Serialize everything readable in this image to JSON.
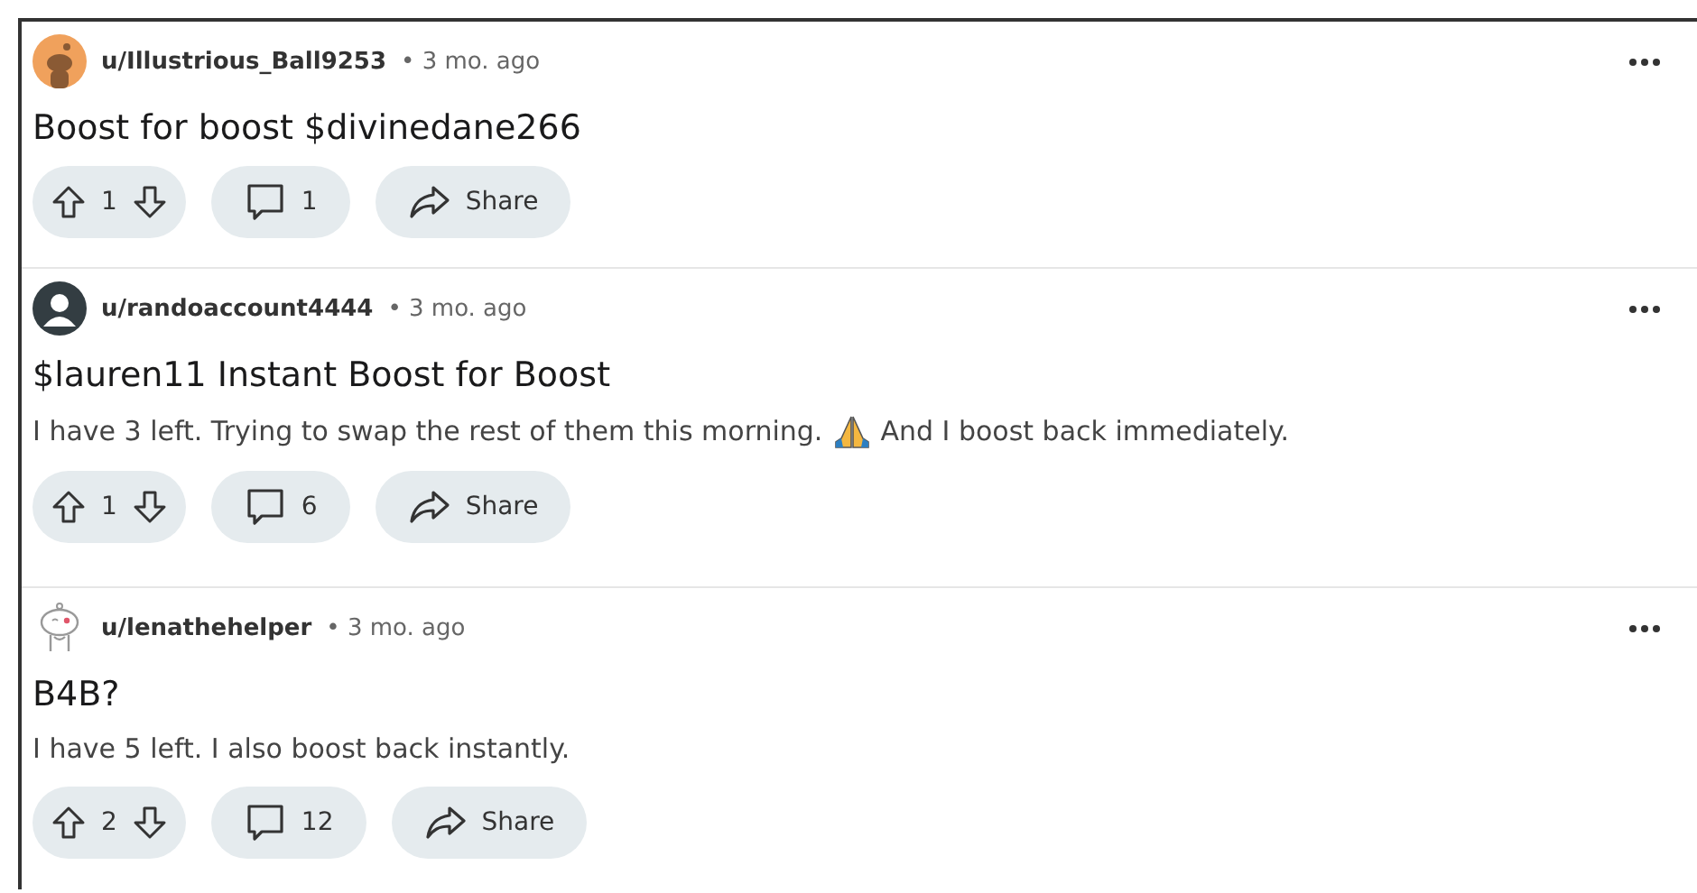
{
  "posts": [
    {
      "avatar": {
        "kind": "snoo-orange"
      },
      "username": "u/Illustrious_Ball9253",
      "time": "• 3 mo. ago",
      "title": "Boost for boost $divinedane266",
      "votes": "1",
      "comments": "1",
      "share": "Share"
    },
    {
      "avatar": {
        "kind": "silhouette"
      },
      "username": "u/randoaccount4444",
      "time": "• 3 mo. ago",
      "title": "$lauren11 Instant Boost for Boost",
      "body": [
        {
          "kind": "text",
          "text": "I have 3 left. Trying to swap the rest of them this morning."
        },
        {
          "kind": "praying-hands"
        },
        {
          "kind": "text",
          "text": "And I boost back immediately."
        }
      ],
      "votes": "1",
      "comments": "6",
      "share": "Share"
    },
    {
      "avatar": {
        "kind": "snoo-outline"
      },
      "username": "u/lenathehelper",
      "time": "• 3 mo. ago",
      "title": "B4B?",
      "body": [
        {
          "kind": "text",
          "text": "I have 5 left. I also boost back instantly."
        }
      ],
      "votes": "2",
      "comments": "12",
      "share": "Share"
    }
  ]
}
